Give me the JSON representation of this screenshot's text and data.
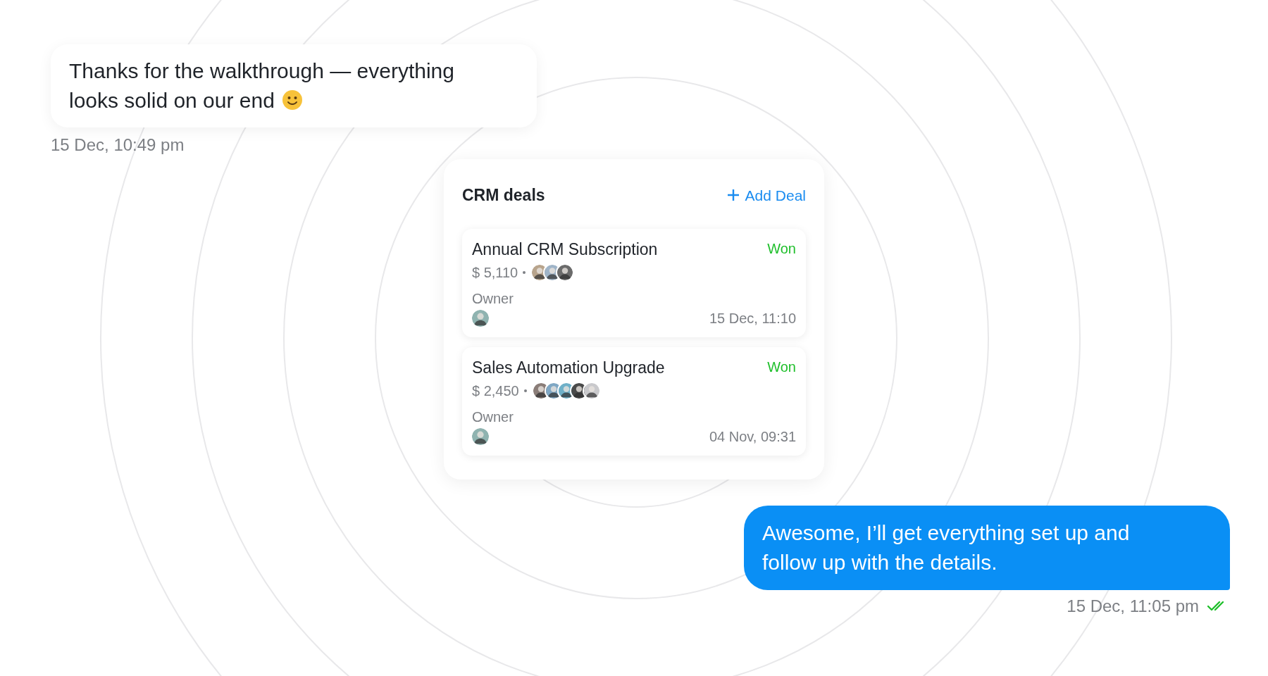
{
  "incoming_message": {
    "text": "Thanks for the walkthrough — everything looks solid on our end",
    "timestamp": "15 Dec, 10:49 pm"
  },
  "crm_card": {
    "title": "CRM deals",
    "add_button": "Add Deal",
    "deals": [
      {
        "name": "Annual CRM Subscription",
        "status": "Won",
        "amount": "$ 5,110",
        "participants": [
          {
            "color": "#b8a48c"
          },
          {
            "color": "#9fb4c8"
          },
          {
            "color": "#6b6b6b"
          }
        ],
        "owner_label": "Owner",
        "date": "15 Dec, 11:10"
      },
      {
        "name": "Sales Automation Upgrade",
        "status": "Won",
        "amount": "$ 2,450",
        "participants": [
          {
            "color": "#8a7d78"
          },
          {
            "color": "#7fa7c4"
          },
          {
            "color": "#6fb0c8"
          },
          {
            "color": "#4a4a4a"
          },
          {
            "color": "#c9c9cc"
          }
        ],
        "owner_label": "Owner",
        "date": "04 Nov, 09:31"
      }
    ]
  },
  "outgoing_message": {
    "text": "Awesome, I’ll get everything set up and follow up with the details.",
    "timestamp": "15 Dec, 11:05 pm",
    "read": true
  }
}
